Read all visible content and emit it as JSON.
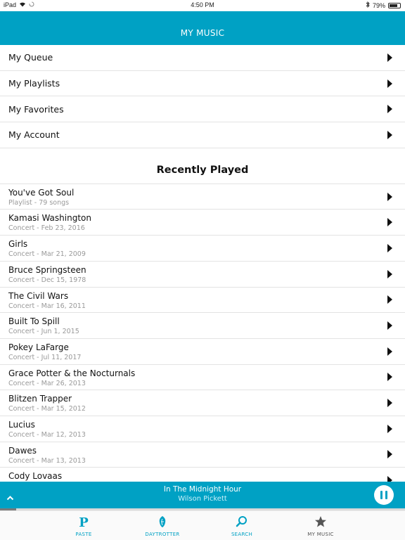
{
  "status": {
    "device": "iPad",
    "time": "4:50 PM",
    "battery": "79%",
    "battery_level": 0.79
  },
  "header": {
    "title": "MY MUSIC"
  },
  "menu": [
    {
      "label": "My Queue"
    },
    {
      "label": "My Playlists"
    },
    {
      "label": "My Favorites"
    },
    {
      "label": "My Account"
    }
  ],
  "recent": {
    "title": "Recently Played",
    "items": [
      {
        "title": "You've Got Soul",
        "subtitle": "Playlist - 79 songs"
      },
      {
        "title": "Kamasi Washington",
        "subtitle": "Concert - Feb 23, 2016"
      },
      {
        "title": "Girls",
        "subtitle": "Concert - Mar 21, 2009"
      },
      {
        "title": "Bruce Springsteen",
        "subtitle": "Concert - Dec 15, 1978"
      },
      {
        "title": "The Civil Wars",
        "subtitle": "Concert - Mar 16, 2011"
      },
      {
        "title": "Built To Spill",
        "subtitle": "Concert - Jun 1, 2015"
      },
      {
        "title": "Pokey LaFarge",
        "subtitle": "Concert - Jul 11, 2017"
      },
      {
        "title": "Grace Potter & the Nocturnals",
        "subtitle": "Concert - Mar 26, 2013"
      },
      {
        "title": "Blitzen Trapper",
        "subtitle": "Concert - Mar 15, 2012"
      },
      {
        "title": "Lucius",
        "subtitle": "Concert - Mar 12, 2013"
      },
      {
        "title": "Dawes",
        "subtitle": "Concert - Mar 13, 2013"
      },
      {
        "title": "Cody Lovaas",
        "subtitle": ""
      }
    ]
  },
  "player": {
    "song": "In The Midnight Hour",
    "artist": "Wilson Pickett",
    "progress": 0.04
  },
  "tabs": [
    {
      "label": "PASTE",
      "icon": "paste-p-icon",
      "color": "#00a1c4"
    },
    {
      "label": "DAYTROTTER",
      "icon": "daytrotter-icon",
      "color": "#00a1c4"
    },
    {
      "label": "SEARCH",
      "icon": "search-icon",
      "color": "#00a1c4"
    },
    {
      "label": "MY MUSIC",
      "icon": "star-icon",
      "color": "#555555"
    }
  ],
  "colors": {
    "accent": "#00a1c4",
    "player_artist": "#c9f0fa"
  }
}
